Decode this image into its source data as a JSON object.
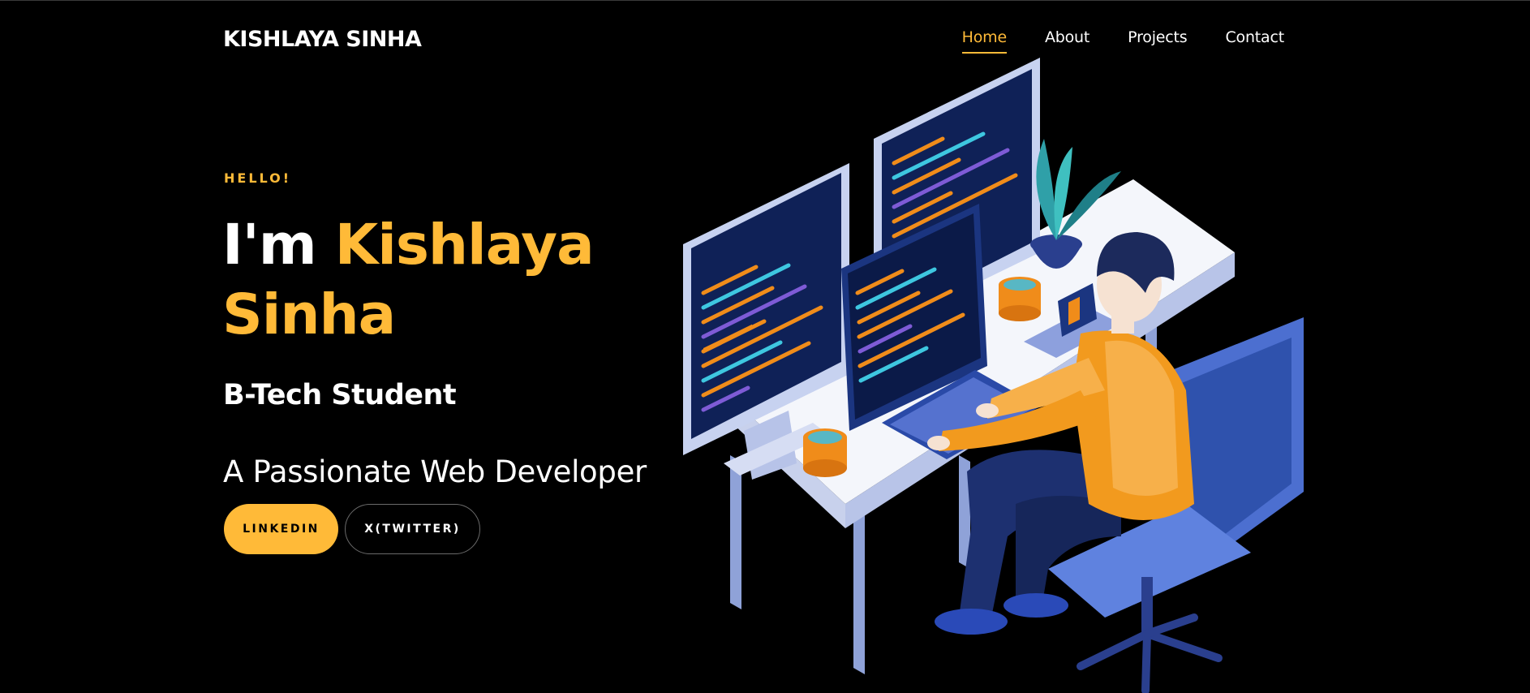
{
  "header": {
    "brand": "KISHLAYA SINHA",
    "nav": [
      "Home",
      "About",
      "Projects",
      "Contact"
    ],
    "active": "Home"
  },
  "hero": {
    "greeting": "HELLO!",
    "intro": "I'm",
    "name_line1": "Kishlaya",
    "name_line2": "Sinha",
    "role": "B-Tech Student",
    "tagline": "A Passionate Web Developer",
    "buttons": {
      "linkedin": "LINKEDIN",
      "twitter": "X(TWITTER)"
    }
  },
  "illustration": {
    "icon": "developer-at-desk-illustration"
  },
  "colors": {
    "background": "#000000",
    "accent": "#ffba38",
    "text": "#ffffff"
  }
}
